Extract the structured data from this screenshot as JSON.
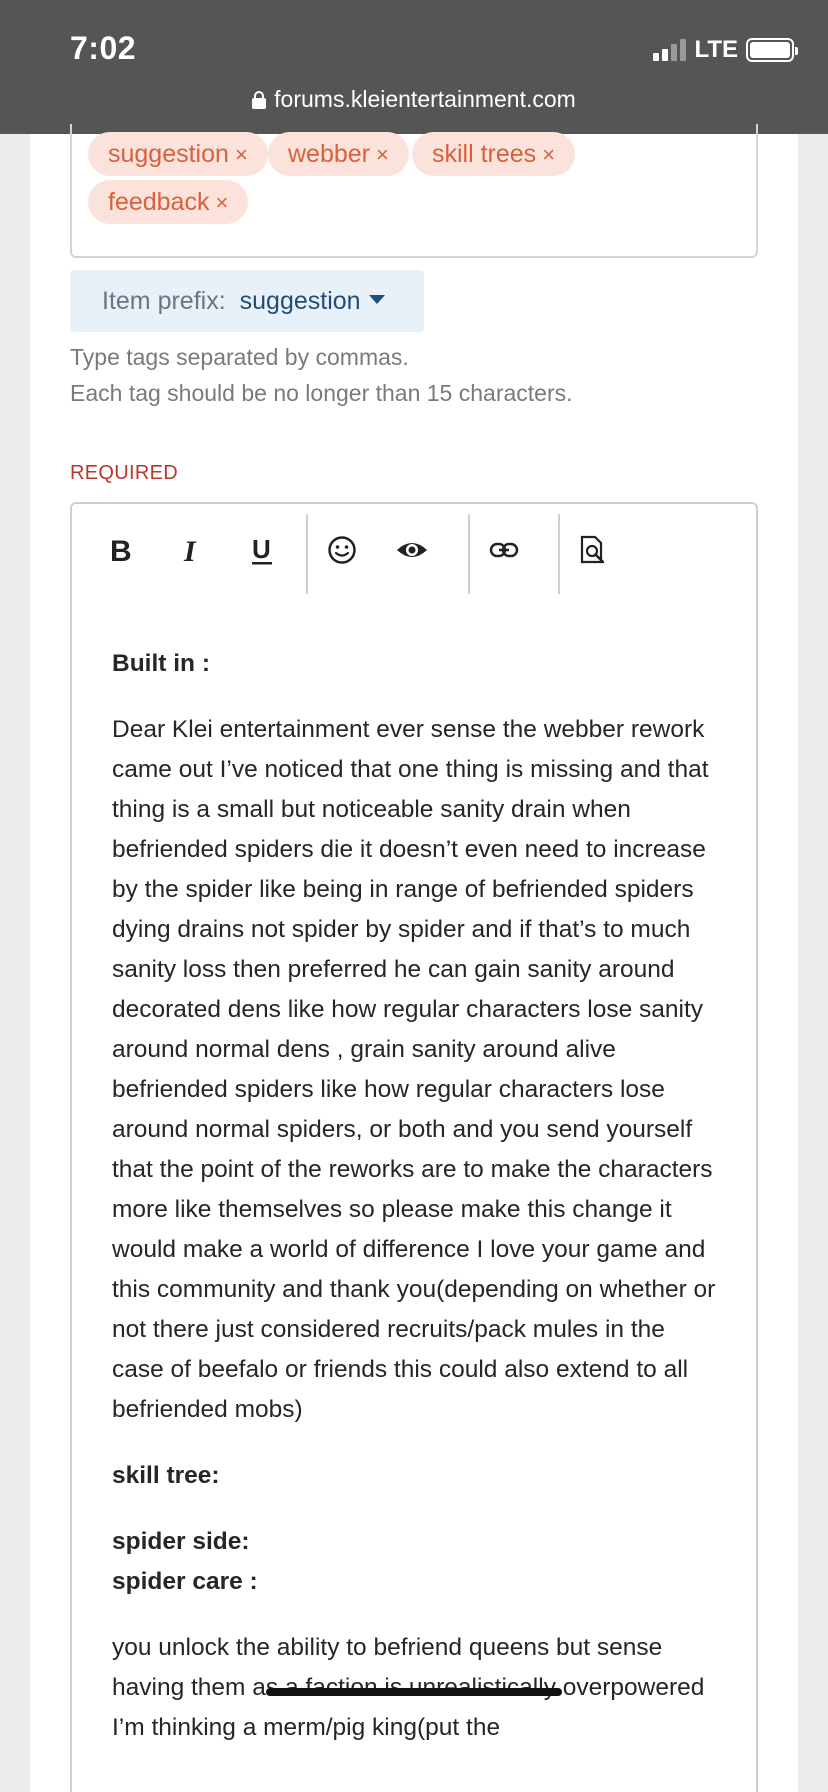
{
  "status": {
    "time": "7:02",
    "network": "LTE"
  },
  "url": "forums.kleientertainment.com",
  "tags": [
    {
      "label": "suggestion",
      "remove": "×"
    },
    {
      "label": "webber",
      "remove": "×"
    },
    {
      "label": "skill trees",
      "remove": "×"
    },
    {
      "label": "feedback",
      "remove": "×"
    }
  ],
  "prefix": {
    "label": "Item prefix:",
    "value": "suggestion"
  },
  "hints": [
    "Type tags separated by commas.",
    "Each tag should be no longer than 15 characters."
  ],
  "required_label": "REQUIRED",
  "toolbar": [
    "bold-icon",
    "italic-icon",
    "underline-icon",
    "emoji-icon",
    "spoiler-eye-icon",
    "link-icon",
    "preview-icon"
  ],
  "body": {
    "heading1": "Built in :",
    "para1": "Dear Klei entertainment ever sense the webber rework came out I’ve noticed that one thing is missing and that thing is a small but noticeable sanity  drain when befriended spiders die it doesn’t even need to increase by the spider like being in range of befriended spiders dying drains not spider by spider and if that’s to much sanity loss then preferred he can gain sanity around decorated dens like how regular characters lose sanity around normal dens , grain sanity around alive befriended spiders like how regular characters lose around normal spiders, or both and you send yourself that the point of the reworks are to make the characters more like themselves so please make this change it would make a world of difference I love your game and this community and thank you(depending on whether or not there just considered recruits/pack mules in the case of beefalo or friends this could also extend to all befriended mobs)",
    "heading2": "skill tree:",
    "heading3": "spider side:",
    "heading4": "spider care :",
    "para2": "you unlock the ability to befriend queens but  sense having them as a faction is unrealistically overpowered I’m thinking a merm/pig king(put the"
  }
}
